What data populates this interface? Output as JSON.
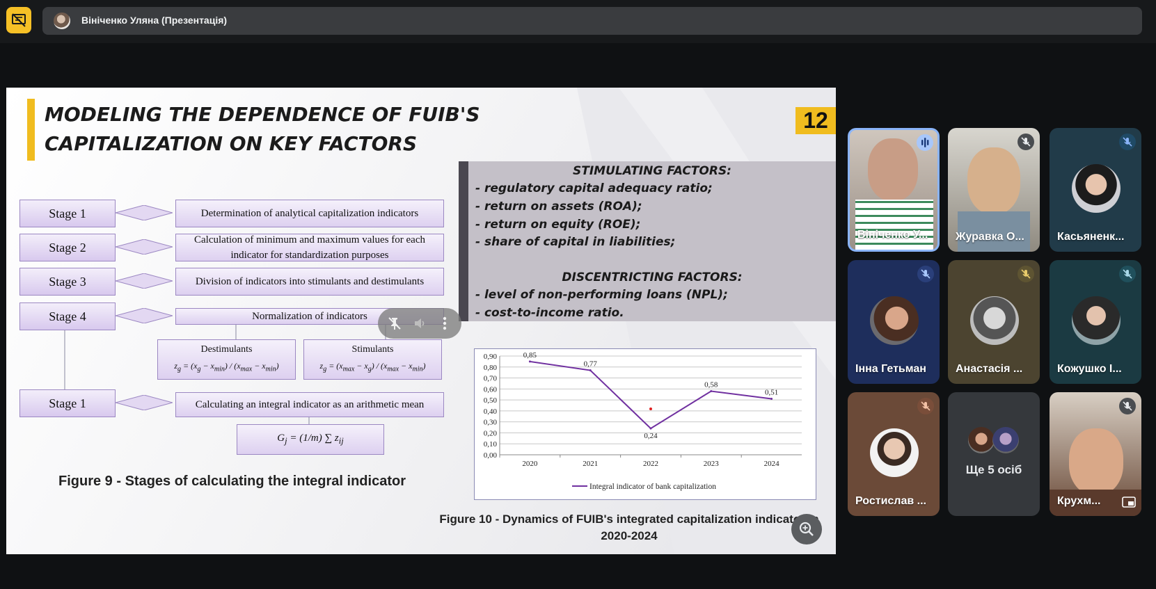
{
  "header": {
    "presenter_title": "Вініченко Уляна (Презентація)"
  },
  "slide": {
    "title_line1": "MODELING THE DEPENDENCE OF FUIB'S",
    "title_line2": "CAPITALIZATION ON KEY FACTORS",
    "number": "12",
    "stimulating_header": "STIMULATING FACTORS:",
    "stimulating": [
      "- regulatory capital adequacy ratio;",
      "- return on assets (ROA);",
      "- return on equity (ROE);",
      "- share of capital in liabilities;"
    ],
    "discentricting_header": "DISCENTRICTING FACTORS:",
    "discentricting": [
      "- level of non-performing loans (NPL);",
      "- cost-to-income ratio."
    ],
    "stages": [
      {
        "label": "Stage 1",
        "desc": "Determination of analytical capitalization indicators"
      },
      {
        "label": "Stage 2",
        "desc": "Calculation of minimum and maximum values for each indicator for standardization purposes"
      },
      {
        "label": "Stage 3",
        "desc": "Division of indicators into stimulants and destimulants"
      },
      {
        "label": "Stage 4",
        "desc": "Normalization of indicators"
      },
      {
        "label": "Stage 1",
        "desc": "Calculating an integral indicator as an arithmetic mean"
      }
    ],
    "destimulants": "Destimulants",
    "stimulants": "Stimulants",
    "figure9_caption": "Figure 9 - Stages of calculating the integral indicator",
    "figure10_caption": "Figure 10 - Dynamics of FUIB's integrated capitalization indicator in 2020-2024"
  },
  "chart_data": {
    "type": "line",
    "x": [
      "2020",
      "2021",
      "2022",
      "2023",
      "2024"
    ],
    "series": [
      {
        "name": "Integral indicator of bank capitalization",
        "values": [
          0.85,
          0.77,
          0.24,
          0.58,
          0.51
        ],
        "color": "#7030a0"
      }
    ],
    "data_labels": [
      "0,85",
      "0,77",
      "0,24",
      "0,58",
      "0,51"
    ],
    "y_ticks": [
      "0,00",
      "0,10",
      "0,20",
      "0,30",
      "0,40",
      "0,50",
      "0,60",
      "0,70",
      "0,80",
      "0,90"
    ],
    "ylim": [
      0,
      0.9
    ],
    "grid": true,
    "legend": "bottom"
  },
  "participants": [
    {
      "name": "Вініченко У...",
      "mic": "speaking",
      "active": true
    },
    {
      "name": "Журавка О...",
      "mic": "muted"
    },
    {
      "name": "Касьяненк...",
      "mic": "muted"
    },
    {
      "name": "Інна Гетьман",
      "mic": "muted"
    },
    {
      "name": "Анастасія ...",
      "mic": "muted"
    },
    {
      "name": "Кожушко І...",
      "mic": "muted"
    },
    {
      "name": "Ростислав ...",
      "mic": "muted"
    },
    {
      "name": "Ще 5 осіб",
      "mic": "none"
    },
    {
      "name": "Крухм...",
      "mic": "muted"
    }
  ],
  "colors": {
    "accent": "#f0bc1f",
    "series": "#7030a0",
    "active_border": "#8ab4f8"
  }
}
